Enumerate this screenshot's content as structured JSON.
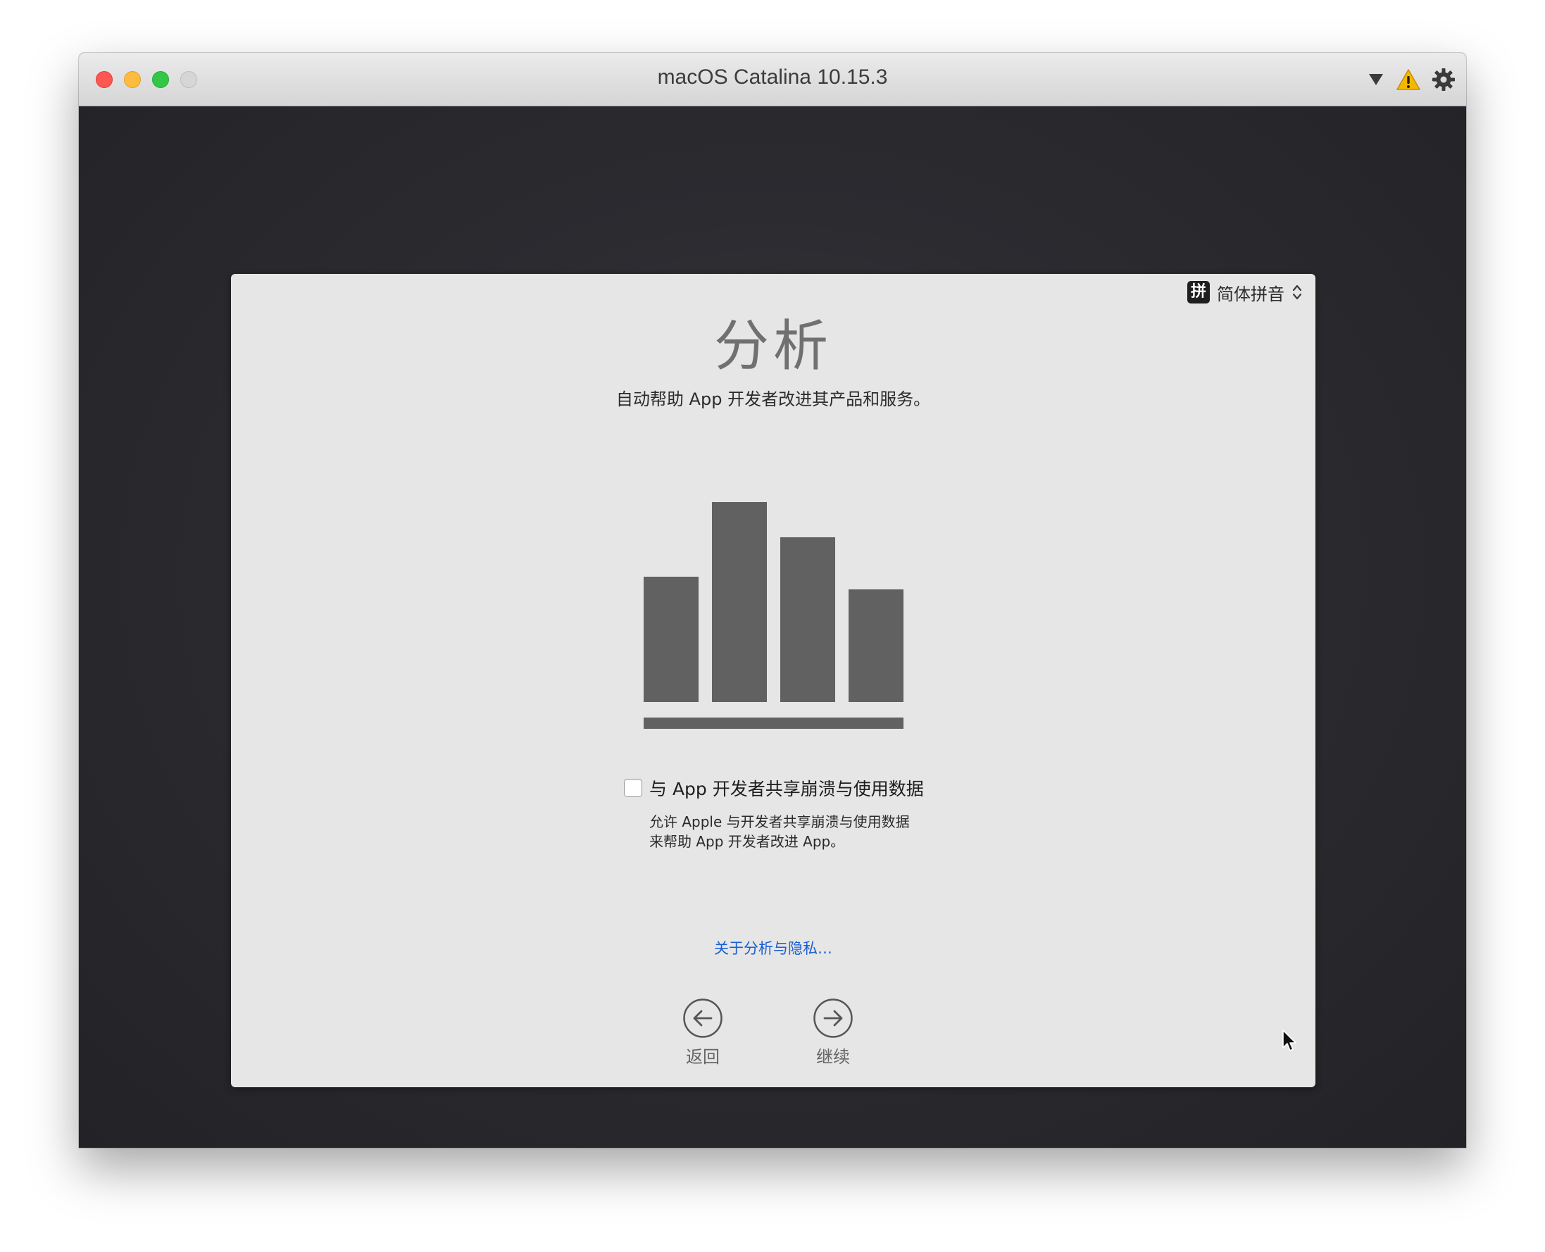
{
  "window": {
    "title": "macOS Catalina 10.15.3",
    "toolbar_icons": [
      "dropdown-triangle-icon",
      "warning-icon",
      "gear-icon"
    ]
  },
  "input_method": {
    "badge": "拼",
    "label": "简体拼音"
  },
  "panel": {
    "heading": "分析",
    "subtitle": "自动帮助 App 开发者改进其产品和服务。",
    "chart_icon": "analytics-bar-chart-icon",
    "share_checkbox": {
      "label": "与 App 开发者共享崩溃与使用数据",
      "checked": false
    },
    "description_lines": [
      "允许 Apple 与开发者共享崩溃与使用数据",
      "来帮助 App 开发者改进 App。"
    ],
    "privacy_link": "关于分析与隐私…",
    "back_label": "返回",
    "continue_label": "继续"
  },
  "colors": {
    "accent_link": "#1a5fd0",
    "chart_gray": "#616161",
    "panel_bg": "#e6e6e6",
    "screen_bg": "#26262b"
  }
}
